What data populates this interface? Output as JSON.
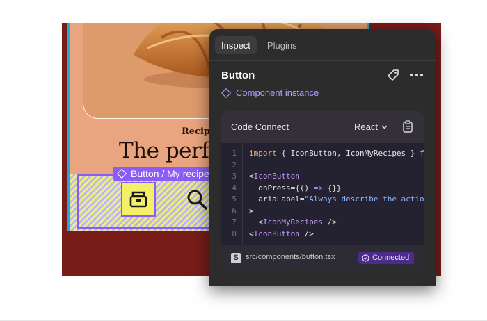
{
  "canvas": {
    "category": "Recipe",
    "headline": "The perfe",
    "selection_tag": "Button / My recipe"
  },
  "panel": {
    "tabs": [
      {
        "label": "Inspect",
        "active": true
      },
      {
        "label": "Plugins",
        "active": false
      }
    ],
    "component_title": "Button",
    "instance_label": "Component instance",
    "code_connect": {
      "title": "Code Connect",
      "language": "React",
      "line_numbers": [
        "1",
        "2",
        "3",
        "4",
        "5",
        "6",
        "7",
        "8"
      ],
      "lines": [
        [
          {
            "t": "import",
            "c": "kw"
          },
          {
            "t": " { IconButton, IconMyRecipes } ",
            "c": ""
          },
          {
            "t": "fr",
            "c": "kw"
          }
        ],
        [],
        [
          {
            "t": "<",
            "c": ""
          },
          {
            "t": "IconButton",
            "c": "tg"
          }
        ],
        [
          {
            "t": "  onPress={() ",
            "c": ""
          },
          {
            "t": "=>",
            "c": "op"
          },
          {
            "t": " {}}",
            "c": ""
          }
        ],
        [
          {
            "t": "  ariaLabel=",
            "c": ""
          },
          {
            "t": "\"Always describe the action",
            "c": "st"
          }
        ],
        [
          {
            "t": ">",
            "c": ""
          }
        ],
        [
          {
            "t": "  <",
            "c": ""
          },
          {
            "t": "IconMyRecipes",
            "c": "tg"
          },
          {
            "t": " />",
            "c": ""
          }
        ],
        [
          {
            "t": "<",
            "c": ""
          },
          {
            "t": "IconButton",
            "c": "tg"
          },
          {
            "t": " />",
            "c": ""
          }
        ]
      ],
      "file_path": "src/components/button.tsx",
      "status": "Connected"
    }
  },
  "colors": {
    "background_stage": "#781c18",
    "panel": "#2c2c2c",
    "accent_purple": "#8b5cf6",
    "code_keyword": "#f1b35c",
    "code_tag": "#c99cff",
    "code_string": "#8fb8ff"
  }
}
